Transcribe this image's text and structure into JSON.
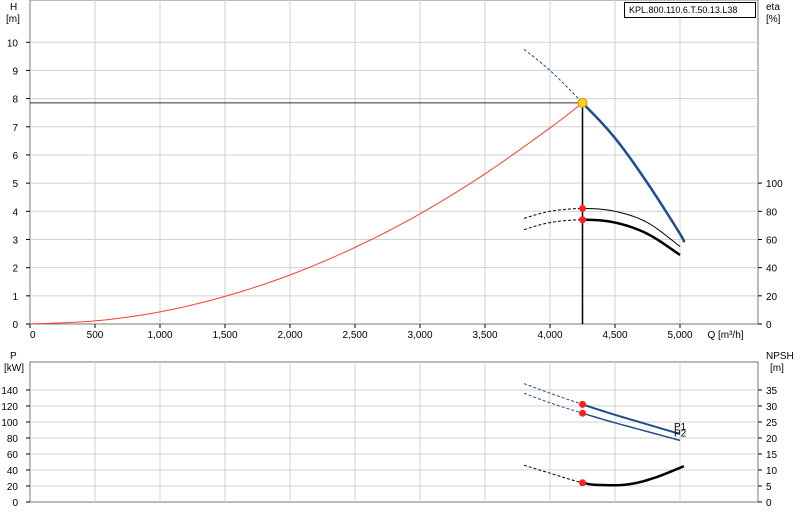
{
  "model": "KPL.800.110.6.T.50.13.L38",
  "chart_data": [
    {
      "type": "line",
      "panel": "top",
      "xlabel": "Q [m³/h]",
      "ylabel_left": [
        "H",
        "[m]"
      ],
      "ylabel_right": [
        "eta",
        "[%]"
      ],
      "xlim": [
        0,
        5600
      ],
      "ylim_left": [
        0,
        11.5
      ],
      "ylim_right": [
        0,
        230
      ],
      "x_ticks": [
        "0",
        "500",
        "1,000",
        "1,500",
        "2,000",
        "2,500",
        "3,000",
        "3,500",
        "4,000",
        "4,500",
        "5,000"
      ],
      "x_tick_values": [
        0,
        500,
        1000,
        1500,
        2000,
        2500,
        3000,
        3500,
        4000,
        4500,
        5000
      ],
      "y_ticks_left": [
        "0",
        "1",
        "2",
        "3",
        "4",
        "5",
        "6",
        "7",
        "8",
        "9",
        "10"
      ],
      "y_ticks_right": [
        "0",
        "20",
        "40",
        "60",
        "80",
        "100"
      ],
      "grid": true,
      "duty_point": {
        "q": 4250,
        "h": 7.85
      },
      "system_curve": {
        "x": [
          0,
          500,
          1000,
          1500,
          2000,
          2500,
          3000,
          3500,
          4000,
          4250
        ],
        "y": [
          0,
          0.11,
          0.43,
          0.98,
          1.74,
          2.72,
          3.91,
          5.33,
          6.96,
          7.85
        ]
      },
      "head_curve": {
        "x": [
          3800,
          4000,
          4250,
          4500,
          4750,
          5000,
          5030
        ],
        "y": [
          9.75,
          9.0,
          7.85,
          6.6,
          5.0,
          3.2,
          2.9
        ],
        "dashed_until": 4250
      },
      "eta_curves": [
        {
          "x": [
            3800,
            4000,
            4250,
            4500,
            4750,
            5000
          ],
          "y": [
            75,
            80,
            82,
            80,
            72,
            55
          ],
          "dashed_until": 4250,
          "width": 1
        },
        {
          "x": [
            3800,
            4000,
            4250,
            4500,
            4750,
            5000
          ],
          "y": [
            67,
            72,
            74,
            72,
            64,
            49
          ],
          "dashed_until": 4250,
          "width": 2.5
        }
      ],
      "eta_points": [
        82,
        74
      ]
    },
    {
      "type": "line",
      "panel": "bottom",
      "ylabel_left": [
        "P",
        "[kW]"
      ],
      "ylabel_right": [
        "NPSH",
        "[m]"
      ],
      "xlim": [
        0,
        5600
      ],
      "ylim_left": [
        0,
        175
      ],
      "ylim_right": [
        0,
        43.75
      ],
      "y_ticks_left": [
        "0",
        "20",
        "40",
        "60",
        "80",
        "100",
        "120",
        "140"
      ],
      "y_ticks_right": [
        "0",
        "5",
        "10",
        "15",
        "20",
        "25",
        "30",
        "35"
      ],
      "grid": true,
      "series": [
        {
          "name": "P1",
          "x": [
            3800,
            4000,
            4250,
            4500,
            4750,
            5000
          ],
          "y": [
            148,
            136,
            122,
            109,
            97,
            85
          ],
          "dashed_until": 4250,
          "color": "#1f4e8c"
        },
        {
          "name": "P2",
          "x": [
            3800,
            4000,
            4250,
            4500,
            4750,
            5000
          ],
          "y": [
            136,
            124,
            111,
            99,
            88,
            77
          ],
          "dashed_until": 4250,
          "color": "#1f4e8c"
        }
      ],
      "npsh": {
        "x": [
          3800,
          4000,
          4250,
          4400,
          4600,
          4800,
          5030
        ],
        "y": [
          11.5,
          9.0,
          6.0,
          5.3,
          5.5,
          7.5,
          11.2
        ],
        "dashed_until": 4250
      },
      "duty_points": {
        "p1": 122,
        "p2": 111,
        "npsh": 6.0
      }
    }
  ]
}
